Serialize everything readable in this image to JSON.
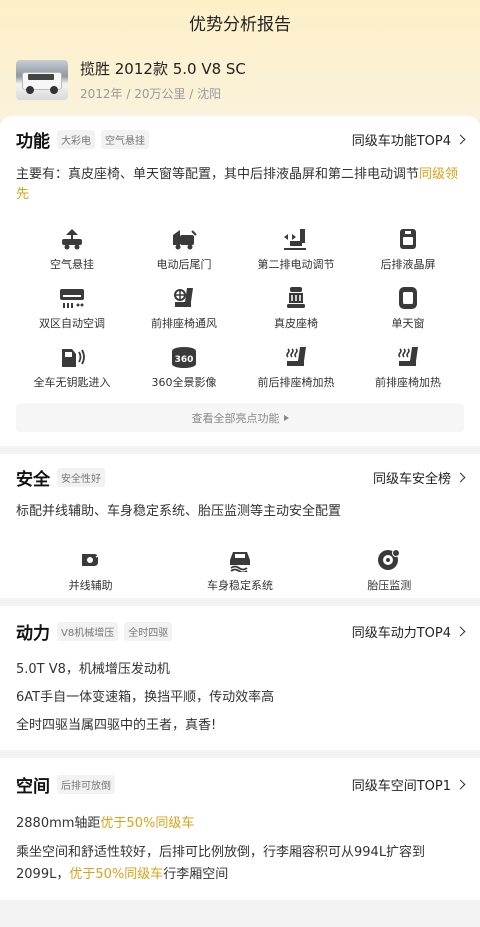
{
  "header": {
    "title": "优势分析报告"
  },
  "car": {
    "name": "揽胜 2012款 5.0 V8 SC",
    "meta": "2012年 / 20万公里 / 沈阳"
  },
  "func": {
    "title": "功能",
    "tags": [
      "大彩电",
      "空气悬挂"
    ],
    "rank": "同级车功能TOP4",
    "desc_pre": "主要有：真皮座椅、单天窗等配置，其中后排液晶屏和第二排电动调节",
    "desc_hl": "同级领先",
    "items": [
      {
        "label": "空气悬挂",
        "icon": "air-suspension-icon"
      },
      {
        "label": "电动后尾门",
        "icon": "power-tailgate-icon"
      },
      {
        "label": "第二排电动调节",
        "icon": "power-seat-adjust-icon"
      },
      {
        "label": "后排液晶屏",
        "icon": "rear-screen-icon"
      },
      {
        "label": "双区自动空调",
        "icon": "dual-zone-ac-icon"
      },
      {
        "label": "前排座椅通风",
        "icon": "seat-ventilation-icon"
      },
      {
        "label": "真皮座椅",
        "icon": "leather-seat-icon"
      },
      {
        "label": "单天窗",
        "icon": "sunroof-icon"
      },
      {
        "label": "全车无钥匙进入",
        "icon": "keyless-entry-icon"
      },
      {
        "label": "360全景影像",
        "icon": "panoramic-camera-icon"
      },
      {
        "label": "前后排座椅加热",
        "icon": "seat-heating-icon"
      },
      {
        "label": "前排座椅加热",
        "icon": "seat-heating-icon"
      }
    ],
    "see_all": "查看全部亮点功能"
  },
  "safety": {
    "title": "安全",
    "tag": "安全性好",
    "rank": "同级车安全榜",
    "desc": "标配并线辅助、车身稳定系统、胎压监测等主动安全配置",
    "items": [
      {
        "label": "并线辅助",
        "icon": "lane-assist-icon"
      },
      {
        "label": "车身稳定系统",
        "icon": "stability-control-icon"
      },
      {
        "label": "胎压监测",
        "icon": "tire-pressure-icon"
      }
    ]
  },
  "power": {
    "title": "动力",
    "tags": [
      "V8机械增压",
      "全时四驱"
    ],
    "rank": "同级车动力TOP4",
    "lines": [
      "5.0T V8，机械增压发动机",
      "6AT手自一体变速箱，换挡平顺，传动效率高",
      "全时四驱当属四驱中的王者，真香!"
    ]
  },
  "space": {
    "title": "空间",
    "tag": "后排可放倒",
    "rank": "同级车空间TOP1",
    "l1_pre": "2880mm轴距",
    "l1_hl": "优于50%同级车",
    "p_pre": "乘坐空间和舒适性较好，后排可比例放倒，行李厢容积可从994L扩容到2099L，",
    "p_hl": "优于50%同级车",
    "p_post": "行李厢空间"
  },
  "colors": {
    "accent": "#d9a21b",
    "icon": "#3a3a3a"
  }
}
